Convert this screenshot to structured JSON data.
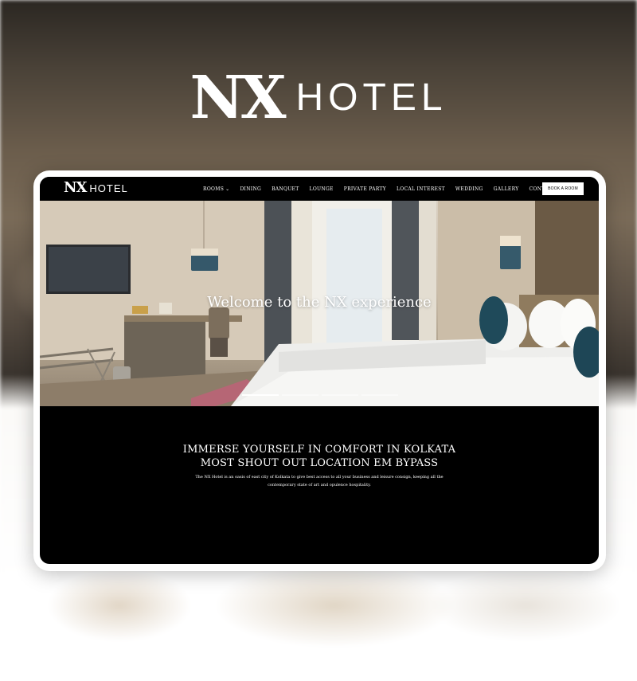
{
  "banner": {
    "logo_mark": "NX",
    "logo_word": "HOTEL"
  },
  "nav": {
    "logo_mark": "NX",
    "logo_word": "HOTEL",
    "items": [
      {
        "label": "ROOMS",
        "has_dropdown": true
      },
      {
        "label": "DINING"
      },
      {
        "label": "BANQUET"
      },
      {
        "label": "LOUNGE"
      },
      {
        "label": "PRIVATE PARTY"
      },
      {
        "label": "LOCAL INTEREST"
      },
      {
        "label": "WEDDING"
      },
      {
        "label": "GALLERY"
      },
      {
        "label": "CONTACT"
      }
    ],
    "cta_label": "BOOK A ROOM"
  },
  "hero": {
    "title": "Welcome to the NX experience",
    "slides": 4,
    "active_slide": 1
  },
  "intro": {
    "heading_line1": "IMMERSE YOURSELF IN COMFORT IN KOLKATA",
    "heading_line2": "MOST SHOUT OUT LOCATION EM BYPASS",
    "body": "The NX Hotel is an oasis of east city of Kolkata to give best access to all your business and leisure consign, keeping all the contemporary state of art and opulence hospitality."
  },
  "colors": {
    "nav_bg": "#000000",
    "cta_bg": "#ffffff",
    "accent_teal": "#1f4a5a"
  }
}
